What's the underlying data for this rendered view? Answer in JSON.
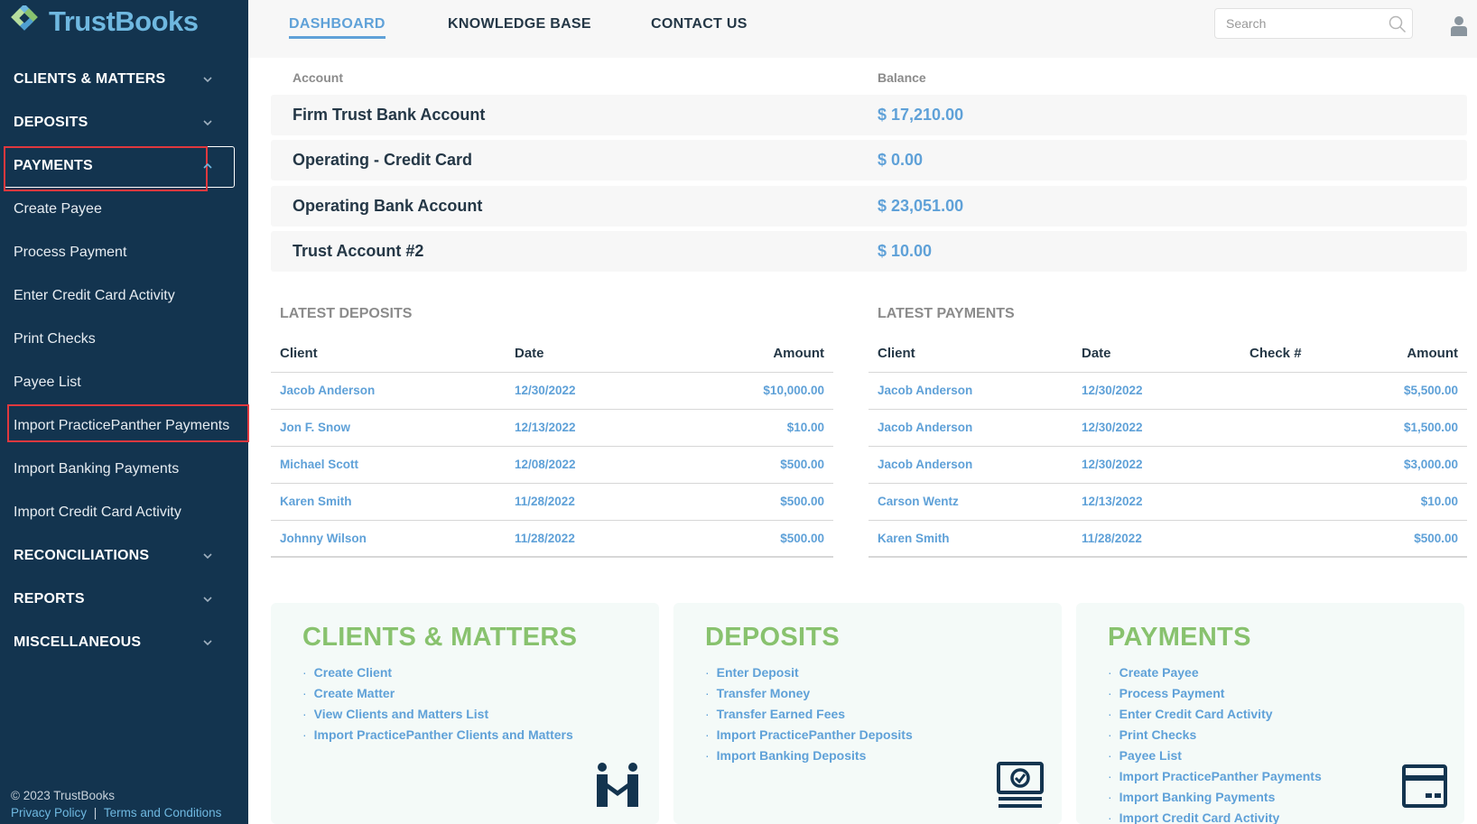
{
  "brand": {
    "name": "TrustBooks"
  },
  "sidebar": {
    "items": [
      {
        "label": "CLIENTS & MATTERS",
        "type": "section",
        "expanded": false
      },
      {
        "label": "DEPOSITS",
        "type": "section",
        "expanded": false
      },
      {
        "label": "PAYMENTS",
        "type": "section",
        "expanded": true
      },
      {
        "label": "Create Payee",
        "type": "sub"
      },
      {
        "label": "Process Payment",
        "type": "sub"
      },
      {
        "label": "Enter Credit Card Activity",
        "type": "sub"
      },
      {
        "label": "Print Checks",
        "type": "sub"
      },
      {
        "label": "Payee List",
        "type": "sub"
      },
      {
        "label": "Import PracticePanther Payments",
        "type": "sub"
      },
      {
        "label": "Import Banking Payments",
        "type": "sub"
      },
      {
        "label": "Import Credit Card Activity",
        "type": "sub"
      },
      {
        "label": "RECONCILIATIONS",
        "type": "section",
        "expanded": false
      },
      {
        "label": "REPORTS",
        "type": "section",
        "expanded": false
      },
      {
        "label": "MISCELLANEOUS",
        "type": "section",
        "expanded": false
      }
    ],
    "footer": {
      "copyright": "© 2023 TrustBooks",
      "privacy": "Privacy Policy",
      "separator": "|",
      "terms": "Terms and Conditions"
    }
  },
  "topnav": {
    "tabs": [
      {
        "label": "DASHBOARD",
        "active": true
      },
      {
        "label": "KNOWLEDGE BASE",
        "active": false
      },
      {
        "label": "CONTACT US",
        "active": false
      }
    ],
    "search_placeholder": "Search"
  },
  "accounts": {
    "col_account": "Account",
    "col_balance": "Balance",
    "rows": [
      {
        "name": "Firm Trust Bank Account",
        "balance": "$ 17,210.00"
      },
      {
        "name": "Operating - Credit Card",
        "balance": "$ 0.00"
      },
      {
        "name": "Operating Bank Account",
        "balance": "$ 23,051.00"
      },
      {
        "name": "Trust Account #2",
        "balance": "$ 10.00"
      }
    ]
  },
  "latest_deposits": {
    "title": "LATEST DEPOSITS",
    "headers": {
      "client": "Client",
      "date": "Date",
      "amount": "Amount"
    },
    "rows": [
      {
        "client": "Jacob Anderson",
        "date": "12/30/2022",
        "amount": "$10,000.00"
      },
      {
        "client": "Jon F. Snow",
        "date": "12/13/2022",
        "amount": "$10.00"
      },
      {
        "client": "Michael Scott",
        "date": "12/08/2022",
        "amount": "$500.00"
      },
      {
        "client": "Karen Smith",
        "date": "11/28/2022",
        "amount": "$500.00"
      },
      {
        "client": "Johnny Wilson",
        "date": "11/28/2022",
        "amount": "$500.00"
      }
    ]
  },
  "latest_payments": {
    "title": "LATEST PAYMENTS",
    "headers": {
      "client": "Client",
      "date": "Date",
      "check": "Check #",
      "amount": "Amount"
    },
    "rows": [
      {
        "client": "Jacob Anderson",
        "date": "12/30/2022",
        "check": "",
        "amount": "$5,500.00"
      },
      {
        "client": "Jacob Anderson",
        "date": "12/30/2022",
        "check": "",
        "amount": "$1,500.00"
      },
      {
        "client": "Jacob Anderson",
        "date": "12/30/2022",
        "check": "",
        "amount": "$3,000.00"
      },
      {
        "client": "Carson Wentz",
        "date": "12/13/2022",
        "check": "",
        "amount": "$10.00"
      },
      {
        "client": "Karen Smith",
        "date": "11/28/2022",
        "check": "",
        "amount": "$500.00"
      }
    ]
  },
  "cards": [
    {
      "title": "CLIENTS & MATTERS",
      "icon": "handshake-icon",
      "links": [
        "Create Client",
        "Create Matter",
        "View Clients and Matters List",
        "Import PracticePanther Clients and Matters"
      ]
    },
    {
      "title": "DEPOSITS",
      "icon": "cash-icon",
      "links": [
        "Enter Deposit",
        "Transfer Money",
        "Transfer Earned Fees",
        "Import PracticePanther Deposits",
        "Import Banking Deposits"
      ]
    },
    {
      "title": "PAYMENTS",
      "icon": "credit-card-icon",
      "links": [
        "Create Payee",
        "Process Payment",
        "Enter Credit Card Activity",
        "Print Checks",
        "Payee List",
        "Import PracticePanther Payments",
        "Import Banking Payments",
        "Import Credit Card Activity"
      ]
    }
  ],
  "colors": {
    "sidebar_bg": "#13344f",
    "accent_blue": "#5fa1d8",
    "accent_green": "#88c26e",
    "highlight_red": "#e0383e"
  }
}
